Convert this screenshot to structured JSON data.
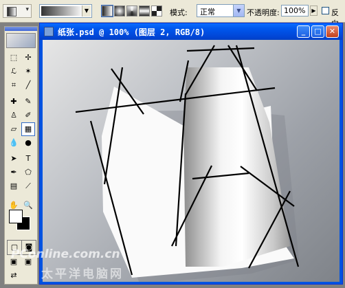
{
  "options_bar": {
    "mode_label": "模式:",
    "mode_value": "正常",
    "opacity_label": "不透明度:",
    "opacity_value": "100%",
    "reverse_label": "反向"
  },
  "document": {
    "title": "纸张.psd @ 100% (图层 2, RGB/8)",
    "min_glyph": "_",
    "max_glyph": "□",
    "close_glyph": "✕"
  },
  "toolbox": {
    "tools": [
      {
        "name": "marquee-tool",
        "glyph": "⬚"
      },
      {
        "name": "move-tool",
        "glyph": "✢"
      },
      {
        "name": "lasso-tool",
        "glyph": "ℒ"
      },
      {
        "name": "magic-wand-tool",
        "glyph": "✶"
      },
      {
        "name": "crop-tool",
        "glyph": "⌗"
      },
      {
        "name": "slice-tool",
        "glyph": "╱"
      },
      {
        "name": "healing-brush-tool",
        "glyph": "✚"
      },
      {
        "name": "brush-tool",
        "glyph": "✎"
      },
      {
        "name": "clone-stamp-tool",
        "glyph": "♙"
      },
      {
        "name": "history-brush-tool",
        "glyph": "✐"
      },
      {
        "name": "eraser-tool",
        "glyph": "▱"
      },
      {
        "name": "gradient-tool",
        "glyph": "▦"
      },
      {
        "name": "blur-tool",
        "glyph": "💧"
      },
      {
        "name": "dodge-tool",
        "glyph": "●"
      },
      {
        "name": "path-select-tool",
        "glyph": "➤"
      },
      {
        "name": "type-tool",
        "glyph": "T"
      },
      {
        "name": "pen-tool",
        "glyph": "✒"
      },
      {
        "name": "shape-tool",
        "glyph": "⬠"
      },
      {
        "name": "notes-tool",
        "glyph": "▤"
      },
      {
        "name": "eyedropper-tool",
        "glyph": "⟋"
      },
      {
        "name": "hand-tool",
        "glyph": "✋"
      },
      {
        "name": "zoom-tool",
        "glyph": "🔍"
      }
    ]
  },
  "watermark": {
    "line1": "PConline.com.cn",
    "line2": "太平洋电脑网"
  },
  "colors": {
    "xp_blue": "#0053e1",
    "toolbar_bg": "#ece9d8"
  }
}
